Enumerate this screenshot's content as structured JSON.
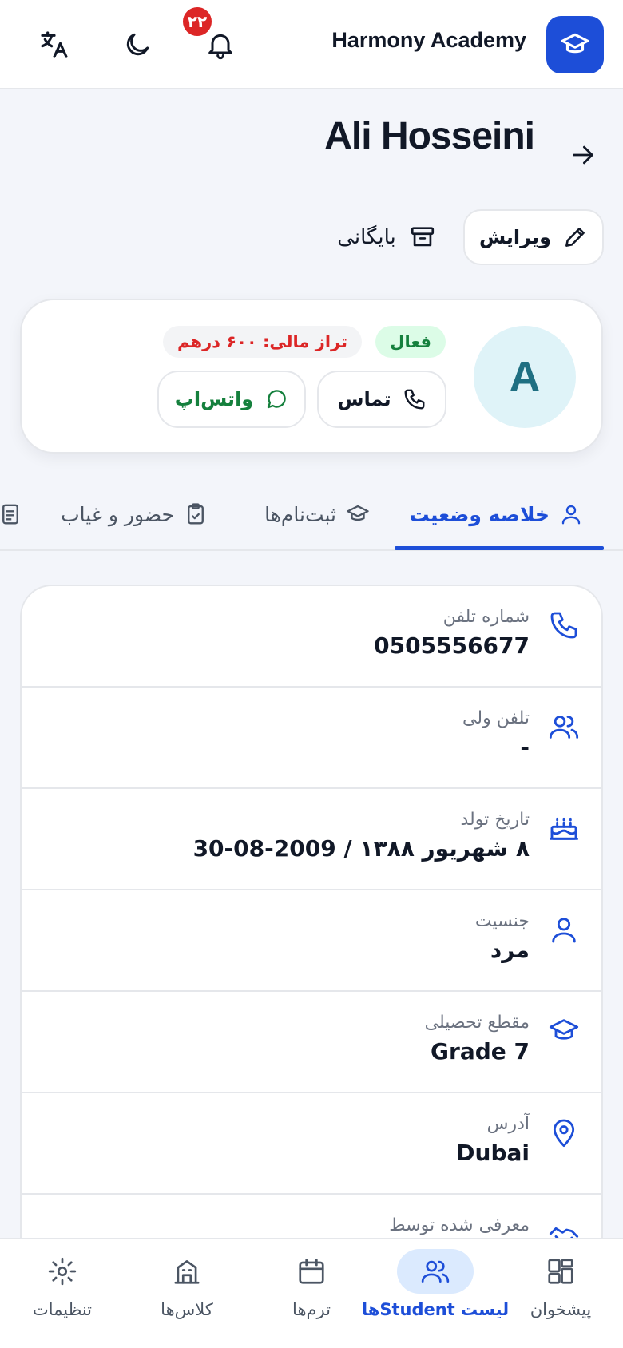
{
  "header": {
    "brand": "Harmony Academy",
    "notification_count": "۲۲",
    "icons": {
      "logo": "graduation-cap-icon",
      "notifications": "bell-icon",
      "theme": "moon-icon",
      "language": "translate-icon"
    }
  },
  "student": {
    "name": "Ali Hosseini",
    "initial": "A",
    "status": "فعال",
    "balance": "تراز مالی: ۶۰۰ درهم"
  },
  "actions": {
    "edit": "ویرایش",
    "archive": "بایگانی",
    "call": "تماس",
    "whatsapp": "واتس‌اپ"
  },
  "tabs": [
    {
      "label": "خلاصه وضعیت",
      "active": true
    },
    {
      "label": "ثبت‌نام‌ها",
      "active": false
    },
    {
      "label": "حضور و غیاب",
      "active": false
    }
  ],
  "info": [
    {
      "label": "شماره تلفن",
      "value": "0505556677",
      "icon": "phone-icon"
    },
    {
      "label": "تلفن ولی",
      "value": "-",
      "icon": "users-icon"
    },
    {
      "label": "تاریخ تولد",
      "value": "۸ شهریور ۱۳۸۸ / 2009-08-30",
      "icon": "cake-icon"
    },
    {
      "label": "جنسیت",
      "value": "مرد",
      "icon": "user-icon"
    },
    {
      "label": "مقطع تحصیلی",
      "value": "Grade 7",
      "icon": "graduation-cap-icon"
    },
    {
      "label": "آدرس",
      "value": "Dubai",
      "icon": "map-pin-icon"
    },
    {
      "label": "معرفی شده توسط",
      "value": "",
      "icon": "handshake-icon"
    }
  ],
  "bottom_nav": [
    {
      "label": "پیشخوان",
      "icon": "dashboard-icon",
      "active": false
    },
    {
      "label": "لیست Studentها",
      "icon": "users-icon",
      "active": true
    },
    {
      "label": "ترم‌ها",
      "icon": "calendar-icon",
      "active": false
    },
    {
      "label": "کلاس‌ها",
      "icon": "building-icon",
      "active": false
    },
    {
      "label": "تنظیمات",
      "icon": "gear-icon",
      "active": false
    }
  ],
  "colors": {
    "primary": "#1d4ed8",
    "success": "#15803d",
    "danger": "#dc2626",
    "background": "#f3f5fa"
  }
}
